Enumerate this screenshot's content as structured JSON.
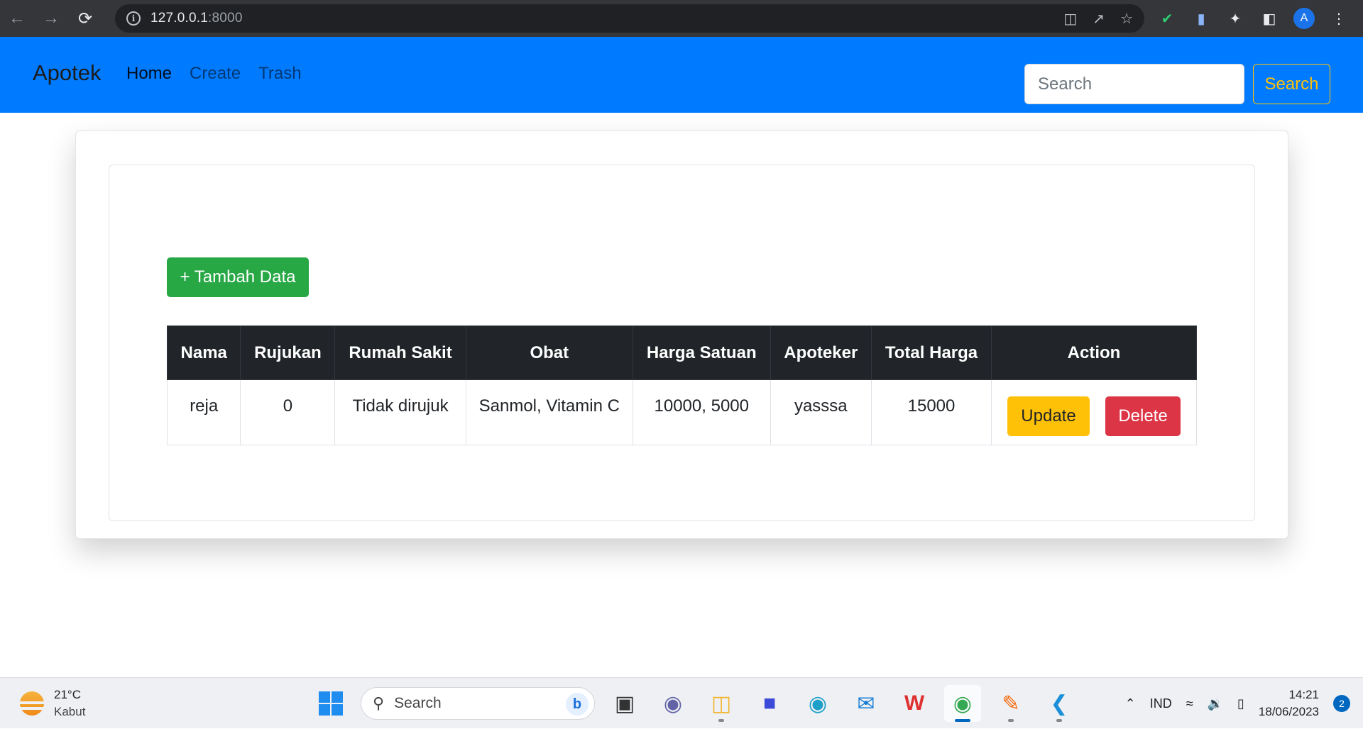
{
  "browser": {
    "url_host": "127.0.0.1",
    "url_port": ":8000",
    "profile_initial": "A"
  },
  "navbar": {
    "brand": "Apotek",
    "links": [
      {
        "label": "Home"
      },
      {
        "label": "Create"
      },
      {
        "label": "Trash"
      }
    ],
    "search_placeholder": "Search",
    "search_button": "Search"
  },
  "main": {
    "add_button": "+ Tambah Data",
    "table": {
      "headers": [
        "Nama",
        "Rujukan",
        "Rumah Sakit",
        "Obat",
        "Harga Satuan",
        "Apoteker",
        "Total Harga",
        "Action"
      ],
      "rows": [
        {
          "nama": "reja",
          "rujukan": "0",
          "rumah_sakit": "Tidak dirujuk",
          "obat": "Sanmol, Vitamin C",
          "harga_satuan": "10000, 5000",
          "apoteker": "yasssa",
          "total_harga": "15000",
          "update_label": "Update",
          "delete_label": "Delete"
        }
      ]
    }
  },
  "taskbar": {
    "weather_temp": "21°C",
    "weather_desc": "Kabut",
    "search_label": "Search",
    "language": "IND",
    "time": "14:21",
    "date": "18/06/2023",
    "notifications": "2"
  },
  "colors": {
    "navbar": "#007bff",
    "success": "#28a745",
    "warning": "#ffc107",
    "danger": "#dc3545",
    "table_header": "#212529"
  }
}
